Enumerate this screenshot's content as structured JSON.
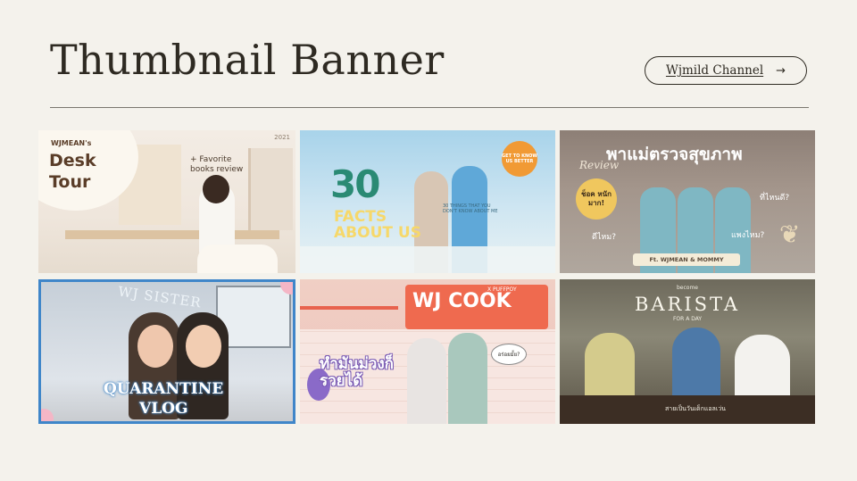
{
  "header": {
    "title": "Thumbnail Banner",
    "channel_button": {
      "label": "Wjmild Channel",
      "arrow": "→"
    }
  },
  "thumbnails": [
    {
      "id": "desk-tour",
      "small": "WJMEAN's",
      "title_line1": "Desk",
      "title_line2": "Tour",
      "note": "+ Favorite books review",
      "year": "2021"
    },
    {
      "id": "30-facts",
      "number": "30",
      "title_line1": "FACTS",
      "title_line2": "ABOUT US",
      "small": "30 THINGS THAT YOU DON'T KNOW ABOUT ME",
      "badge": "GET TO KNOW US BETTER"
    },
    {
      "id": "health-check",
      "title": "พาแม่ตรวจสุขภาพ",
      "review": "Review",
      "badge": "ช็อค หนัก มาก!",
      "q1": "ที่ไหนดี?",
      "q2": "ดีไหม?",
      "q3": "แพงไหม?",
      "ft": "Ft. WJMEAN & MOMMY"
    },
    {
      "id": "quarantine",
      "overlay": "WJ SISTER",
      "title_line1": "QUARANTINE",
      "title_line2": "VLOG"
    },
    {
      "id": "wj-cook",
      "sign": "WJ COOK",
      "collab": "X PUFFPOY",
      "thai": "ทำมันม่วงก็รวยได้",
      "bubble": "อร่อยมั้ย?"
    },
    {
      "id": "barista",
      "become": "become",
      "title": "BARISTA",
      "for_a_day": "FOR A DAY",
      "subtitle": "สายเป็นวันเด็กแอลเว่น"
    }
  ],
  "colors": {
    "background": "#f4f2ec",
    "text": "#2e2a22",
    "quarantine_border": "#3f86c9"
  }
}
